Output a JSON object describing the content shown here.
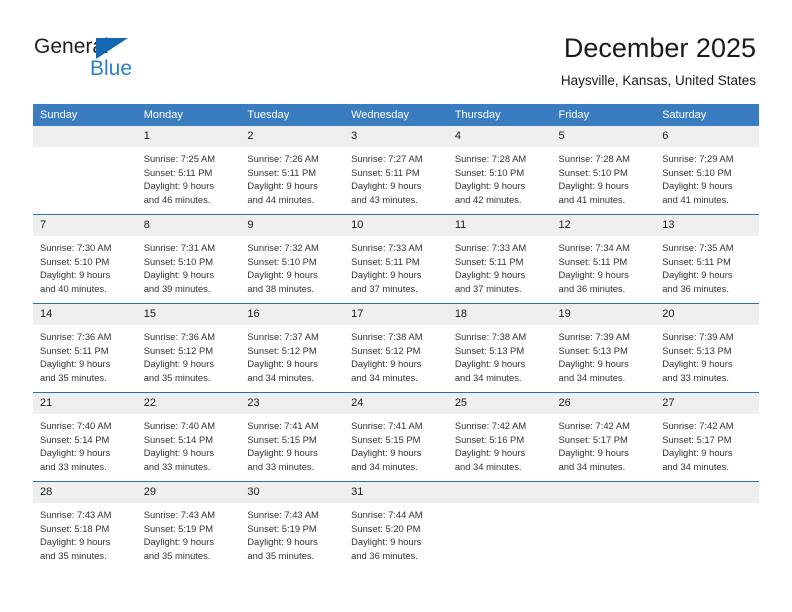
{
  "brand": {
    "name_dark": "General",
    "name_blue": "Blue",
    "triangle_color": "#1667b2",
    "blue_color": "#2a7fd4"
  },
  "header": {
    "title": "December 2025",
    "subtitle": "Haysville, Kansas, United States"
  },
  "theme": {
    "header_row_bg": "#3a7cc0",
    "week_divider": "#2f6fad",
    "daynum_bg": "#efefef"
  },
  "weekday_headers": [
    "Sunday",
    "Monday",
    "Tuesday",
    "Wednesday",
    "Thursday",
    "Friday",
    "Saturday"
  ],
  "weeks": [
    [
      {
        "day": "",
        "sunrise": "",
        "sunset": "",
        "daylight_1": "",
        "daylight_2": "",
        "empty": true
      },
      {
        "day": "1",
        "sunrise": "Sunrise: 7:25 AM",
        "sunset": "Sunset: 5:11 PM",
        "daylight_1": "Daylight: 9 hours",
        "daylight_2": "and 46 minutes."
      },
      {
        "day": "2",
        "sunrise": "Sunrise: 7:26 AM",
        "sunset": "Sunset: 5:11 PM",
        "daylight_1": "Daylight: 9 hours",
        "daylight_2": "and 44 minutes."
      },
      {
        "day": "3",
        "sunrise": "Sunrise: 7:27 AM",
        "sunset": "Sunset: 5:11 PM",
        "daylight_1": "Daylight: 9 hours",
        "daylight_2": "and 43 minutes."
      },
      {
        "day": "4",
        "sunrise": "Sunrise: 7:28 AM",
        "sunset": "Sunset: 5:10 PM",
        "daylight_1": "Daylight: 9 hours",
        "daylight_2": "and 42 minutes."
      },
      {
        "day": "5",
        "sunrise": "Sunrise: 7:28 AM",
        "sunset": "Sunset: 5:10 PM",
        "daylight_1": "Daylight: 9 hours",
        "daylight_2": "and 41 minutes."
      },
      {
        "day": "6",
        "sunrise": "Sunrise: 7:29 AM",
        "sunset": "Sunset: 5:10 PM",
        "daylight_1": "Daylight: 9 hours",
        "daylight_2": "and 41 minutes."
      }
    ],
    [
      {
        "day": "7",
        "sunrise": "Sunrise: 7:30 AM",
        "sunset": "Sunset: 5:10 PM",
        "daylight_1": "Daylight: 9 hours",
        "daylight_2": "and 40 minutes."
      },
      {
        "day": "8",
        "sunrise": "Sunrise: 7:31 AM",
        "sunset": "Sunset: 5:10 PM",
        "daylight_1": "Daylight: 9 hours",
        "daylight_2": "and 39 minutes."
      },
      {
        "day": "9",
        "sunrise": "Sunrise: 7:32 AM",
        "sunset": "Sunset: 5:10 PM",
        "daylight_1": "Daylight: 9 hours",
        "daylight_2": "and 38 minutes."
      },
      {
        "day": "10",
        "sunrise": "Sunrise: 7:33 AM",
        "sunset": "Sunset: 5:11 PM",
        "daylight_1": "Daylight: 9 hours",
        "daylight_2": "and 37 minutes."
      },
      {
        "day": "11",
        "sunrise": "Sunrise: 7:33 AM",
        "sunset": "Sunset: 5:11 PM",
        "daylight_1": "Daylight: 9 hours",
        "daylight_2": "and 37 minutes."
      },
      {
        "day": "12",
        "sunrise": "Sunrise: 7:34 AM",
        "sunset": "Sunset: 5:11 PM",
        "daylight_1": "Daylight: 9 hours",
        "daylight_2": "and 36 minutes."
      },
      {
        "day": "13",
        "sunrise": "Sunrise: 7:35 AM",
        "sunset": "Sunset: 5:11 PM",
        "daylight_1": "Daylight: 9 hours",
        "daylight_2": "and 36 minutes."
      }
    ],
    [
      {
        "day": "14",
        "sunrise": "Sunrise: 7:36 AM",
        "sunset": "Sunset: 5:11 PM",
        "daylight_1": "Daylight: 9 hours",
        "daylight_2": "and 35 minutes."
      },
      {
        "day": "15",
        "sunrise": "Sunrise: 7:36 AM",
        "sunset": "Sunset: 5:12 PM",
        "daylight_1": "Daylight: 9 hours",
        "daylight_2": "and 35 minutes."
      },
      {
        "day": "16",
        "sunrise": "Sunrise: 7:37 AM",
        "sunset": "Sunset: 5:12 PM",
        "daylight_1": "Daylight: 9 hours",
        "daylight_2": "and 34 minutes."
      },
      {
        "day": "17",
        "sunrise": "Sunrise: 7:38 AM",
        "sunset": "Sunset: 5:12 PM",
        "daylight_1": "Daylight: 9 hours",
        "daylight_2": "and 34 minutes."
      },
      {
        "day": "18",
        "sunrise": "Sunrise: 7:38 AM",
        "sunset": "Sunset: 5:13 PM",
        "daylight_1": "Daylight: 9 hours",
        "daylight_2": "and 34 minutes."
      },
      {
        "day": "19",
        "sunrise": "Sunrise: 7:39 AM",
        "sunset": "Sunset: 5:13 PM",
        "daylight_1": "Daylight: 9 hours",
        "daylight_2": "and 34 minutes."
      },
      {
        "day": "20",
        "sunrise": "Sunrise: 7:39 AM",
        "sunset": "Sunset: 5:13 PM",
        "daylight_1": "Daylight: 9 hours",
        "daylight_2": "and 33 minutes."
      }
    ],
    [
      {
        "day": "21",
        "sunrise": "Sunrise: 7:40 AM",
        "sunset": "Sunset: 5:14 PM",
        "daylight_1": "Daylight: 9 hours",
        "daylight_2": "and 33 minutes."
      },
      {
        "day": "22",
        "sunrise": "Sunrise: 7:40 AM",
        "sunset": "Sunset: 5:14 PM",
        "daylight_1": "Daylight: 9 hours",
        "daylight_2": "and 33 minutes."
      },
      {
        "day": "23",
        "sunrise": "Sunrise: 7:41 AM",
        "sunset": "Sunset: 5:15 PM",
        "daylight_1": "Daylight: 9 hours",
        "daylight_2": "and 33 minutes."
      },
      {
        "day": "24",
        "sunrise": "Sunrise: 7:41 AM",
        "sunset": "Sunset: 5:15 PM",
        "daylight_1": "Daylight: 9 hours",
        "daylight_2": "and 34 minutes."
      },
      {
        "day": "25",
        "sunrise": "Sunrise: 7:42 AM",
        "sunset": "Sunset: 5:16 PM",
        "daylight_1": "Daylight: 9 hours",
        "daylight_2": "and 34 minutes."
      },
      {
        "day": "26",
        "sunrise": "Sunrise: 7:42 AM",
        "sunset": "Sunset: 5:17 PM",
        "daylight_1": "Daylight: 9 hours",
        "daylight_2": "and 34 minutes."
      },
      {
        "day": "27",
        "sunrise": "Sunrise: 7:42 AM",
        "sunset": "Sunset: 5:17 PM",
        "daylight_1": "Daylight: 9 hours",
        "daylight_2": "and 34 minutes."
      }
    ],
    [
      {
        "day": "28",
        "sunrise": "Sunrise: 7:43 AM",
        "sunset": "Sunset: 5:18 PM",
        "daylight_1": "Daylight: 9 hours",
        "daylight_2": "and 35 minutes."
      },
      {
        "day": "29",
        "sunrise": "Sunrise: 7:43 AM",
        "sunset": "Sunset: 5:19 PM",
        "daylight_1": "Daylight: 9 hours",
        "daylight_2": "and 35 minutes."
      },
      {
        "day": "30",
        "sunrise": "Sunrise: 7:43 AM",
        "sunset": "Sunset: 5:19 PM",
        "daylight_1": "Daylight: 9 hours",
        "daylight_2": "and 35 minutes."
      },
      {
        "day": "31",
        "sunrise": "Sunrise: 7:44 AM",
        "sunset": "Sunset: 5:20 PM",
        "daylight_1": "Daylight: 9 hours",
        "daylight_2": "and 36 minutes."
      },
      {
        "day": "",
        "sunrise": "",
        "sunset": "",
        "daylight_1": "",
        "daylight_2": "",
        "empty": true
      },
      {
        "day": "",
        "sunrise": "",
        "sunset": "",
        "daylight_1": "",
        "daylight_2": "",
        "empty": true
      },
      {
        "day": "",
        "sunrise": "",
        "sunset": "",
        "daylight_1": "",
        "daylight_2": "",
        "empty": true
      }
    ]
  ]
}
